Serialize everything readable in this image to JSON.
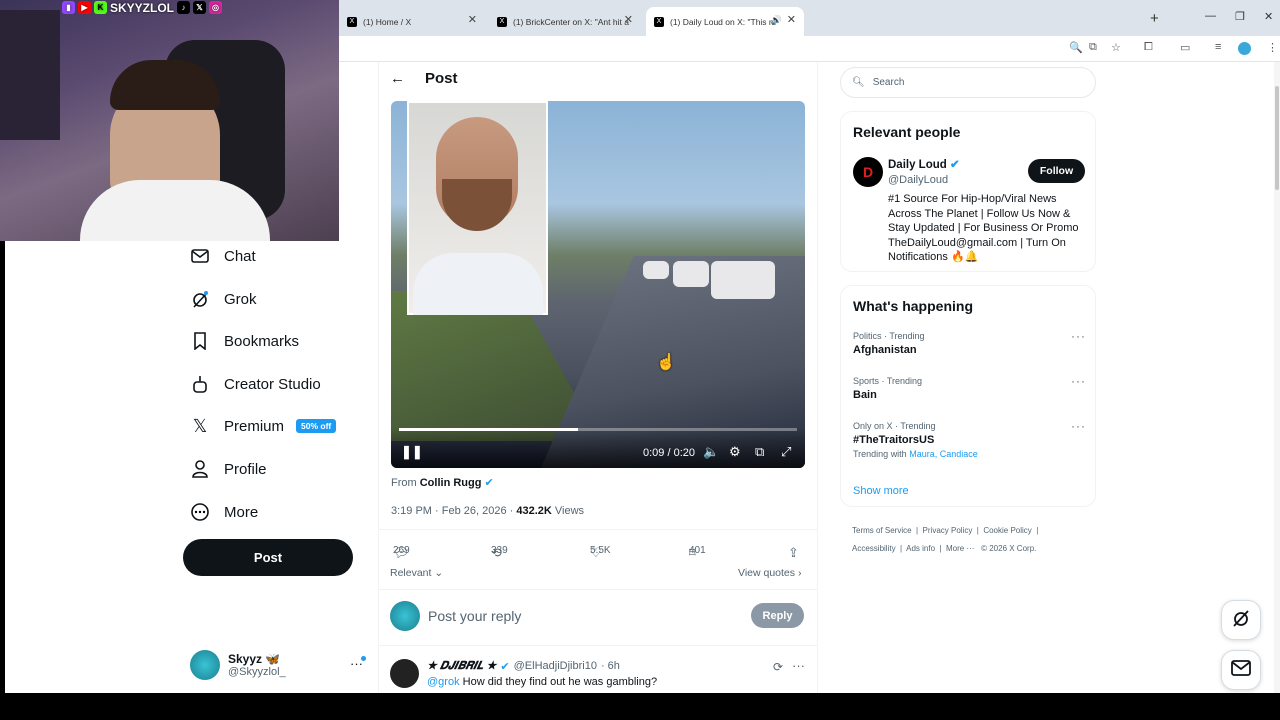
{
  "browser": {
    "tabs": [
      {
        "label": "(1) Home / X"
      },
      {
        "label": "(1) BrickCenter on X: \"Ant hit a"
      },
      {
        "label": "(1) Daily Loud on X: \"This m"
      }
    ],
    "new_tab": "+"
  },
  "stream": {
    "overlay_name": "SKYYZLOL"
  },
  "sidebar": {
    "items": [
      {
        "label": "Chat",
        "icon": "mail-icon"
      },
      {
        "label": "Grok",
        "icon": "grok-icon"
      },
      {
        "label": "Bookmarks",
        "icon": "bookmark-icon"
      },
      {
        "label": "Creator Studio",
        "icon": "creator-studio-icon"
      },
      {
        "label": "Premium",
        "icon": "x-logo-icon",
        "badge": "50% off"
      },
      {
        "label": "Profile",
        "icon": "person-icon"
      },
      {
        "label": "More",
        "icon": "more-circle-icon"
      }
    ],
    "post_button": "Post",
    "account": {
      "name": "Skyyz 🦋",
      "handle": "@Skyyzlol_"
    }
  },
  "main": {
    "header_title": "Post",
    "video": {
      "time": "0:09 / 0:20",
      "progress": 0.45
    },
    "from_label": "From",
    "from_name": "Collin Rugg",
    "meta_time": "3:19 PM · Feb 26, 2026 ·",
    "views_count": "432.2K",
    "views_label": "Views",
    "actions": {
      "replies": "269",
      "reposts": "339",
      "likes": "5.5K",
      "bookmarks": "401"
    },
    "relevant_label": "Relevant",
    "view_quotes": "View quotes",
    "reply_placeholder": "Post your reply",
    "reply_button": "Reply",
    "comment": {
      "name": "★ 𝑫𝑱𝑰𝑩𝑹𝑰𝑳 ★",
      "handle": "@ElHadjiDjibri10",
      "time": "· 6h",
      "mention": "@grok",
      "text": "How did they find out he was gambling?"
    }
  },
  "right": {
    "search_placeholder": "Search",
    "relevant_people": {
      "title": "Relevant people",
      "name": "Daily Loud",
      "handle": "@DailyLoud",
      "bio": "#1 Source For Hip-Hop/Viral News Across The Planet | Follow Us Now & Stay Updated | For Business Or Promo TheDailyLoud@gmail.com | Turn On Notifications 🔥🔔",
      "follow": "Follow"
    },
    "happening": {
      "title": "What's happening",
      "trends": [
        {
          "category": "Politics · Trending",
          "name": "Afghanistan"
        },
        {
          "category": "Sports · Trending",
          "name": "Bain"
        },
        {
          "category": "Only on X · Trending",
          "name": "#TheTraitorsUS",
          "with_label": "Trending with",
          "with_names": "Maura, Candiace"
        }
      ],
      "show_more": "Show more"
    },
    "footer": {
      "terms": "Terms of Service",
      "privacy": "Privacy Policy",
      "cookie": "Cookie Policy",
      "accessibility": "Accessibility",
      "ads": "Ads info",
      "more": "More ···",
      "copyright": "© 2026 X Corp."
    }
  }
}
